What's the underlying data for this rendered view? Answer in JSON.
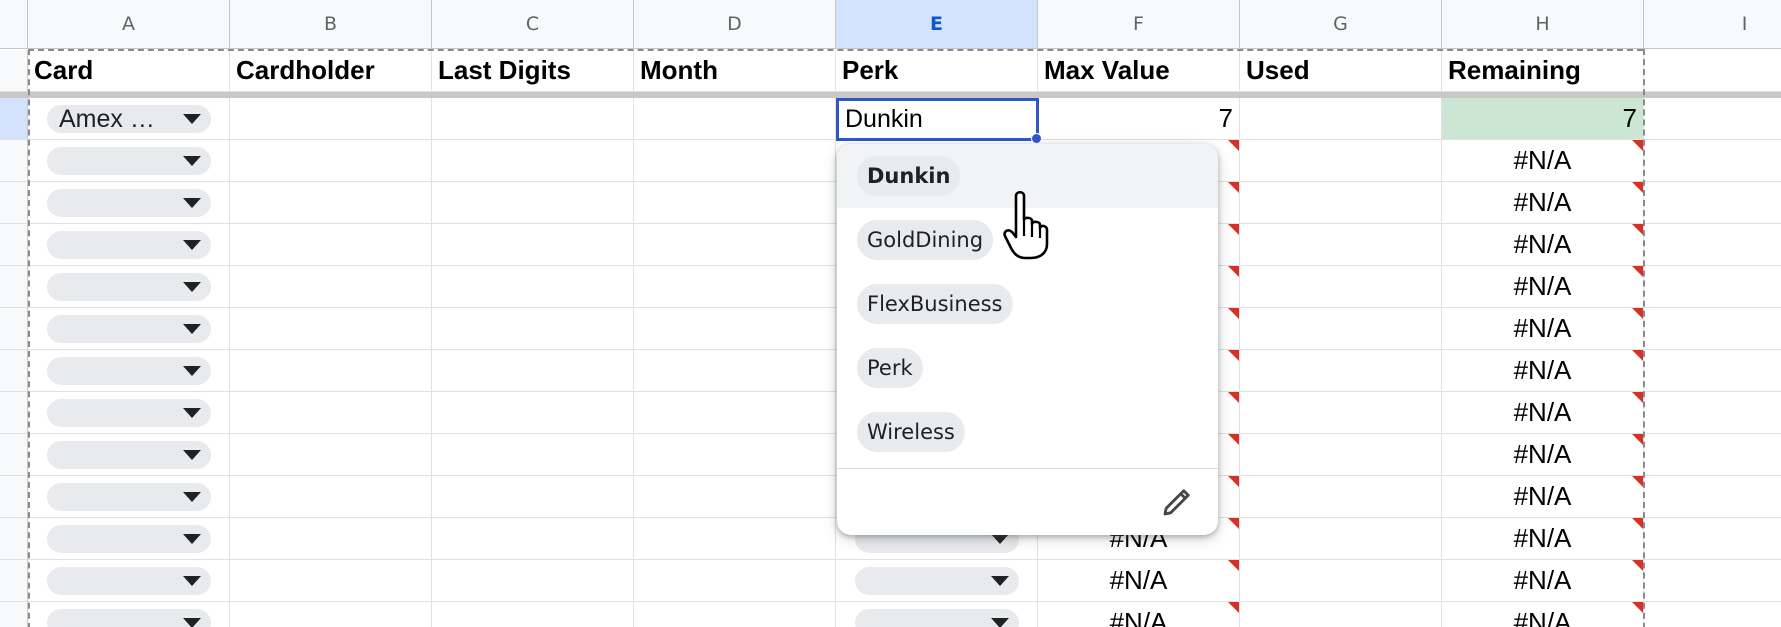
{
  "columns": [
    "A",
    "B",
    "C",
    "D",
    "E",
    "F",
    "G",
    "H",
    "I"
  ],
  "selected_column": "E",
  "headers": [
    "Card",
    "Cardholder",
    "Last Digits",
    "Month",
    "Perk",
    "Max Value",
    "Used",
    "Remaining"
  ],
  "first_row": {
    "card_chip": "Amex …",
    "perk_input": "Dunkin",
    "max_value": "7",
    "remaining": "7"
  },
  "error_text": "#N/A",
  "perk_dropdown": {
    "options": [
      "Dunkin",
      "GoldDining",
      "FlexBusiness",
      "Perk",
      "Wireless"
    ],
    "highlighted": "Dunkin",
    "edit_icon": "pencil-icon"
  },
  "colors": {
    "accent": "#2f57c7",
    "selected_header": "#d3e3fd",
    "remaining_highlight": "#cbe6d3",
    "error_marker": "#d93025"
  }
}
